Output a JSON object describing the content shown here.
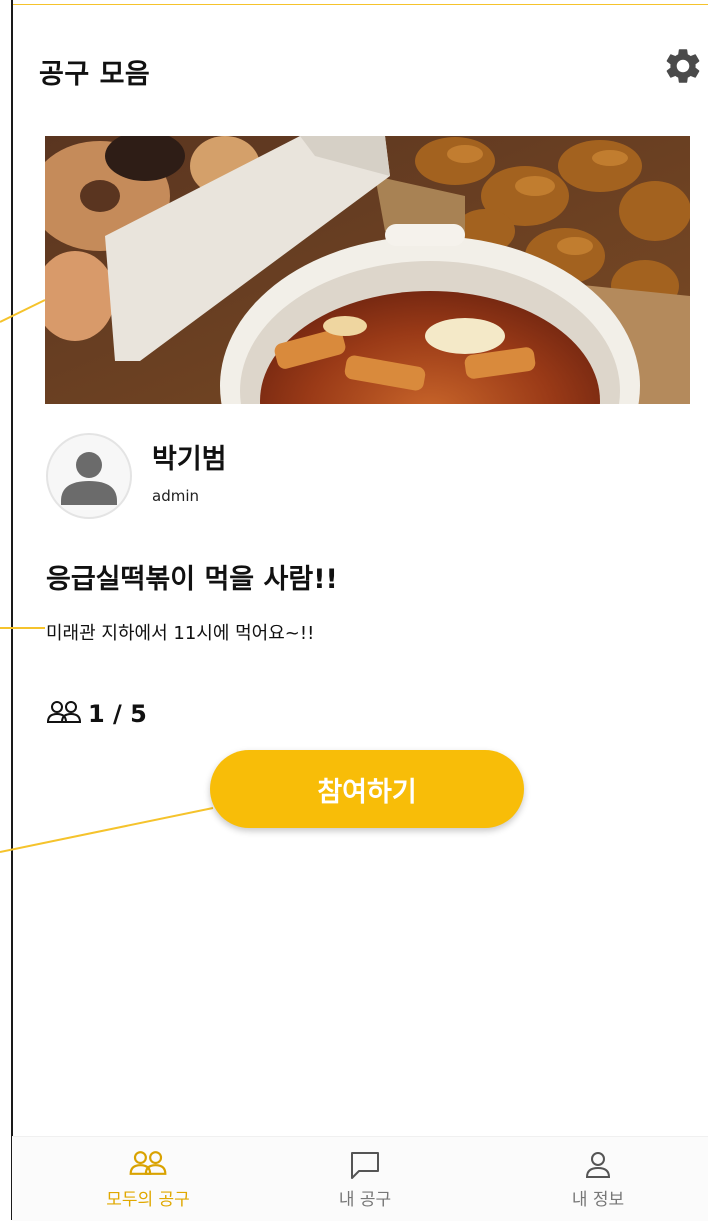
{
  "header": {
    "title": "공구 모음",
    "settings_icon": "gear-icon"
  },
  "post": {
    "image_alt": "떡볶이, 닭강정, 도넛",
    "author": {
      "name": "박기범",
      "role": "admin",
      "avatar_icon": "user-avatar-icon"
    },
    "title": "응급실떡볶이 먹을 사람!!",
    "description": "미래관 지하에서 11시에 먹어요~!!",
    "participants": {
      "icon": "group-icon",
      "count_text": "1 / 5",
      "current": 1,
      "max": 5
    },
    "join_label": "참여하기"
  },
  "bottom_nav": [
    {
      "label": "모두의 공구",
      "icon": "group-icon",
      "active": true
    },
    {
      "label": "내 공구",
      "icon": "chat-icon",
      "active": false
    },
    {
      "label": "내 정보",
      "icon": "person-icon",
      "active": false
    }
  ],
  "colors": {
    "accent": "#F8BD08",
    "active_nav": "#E0A800",
    "inactive_nav": "#777777",
    "annotation": "#F5C32C"
  }
}
